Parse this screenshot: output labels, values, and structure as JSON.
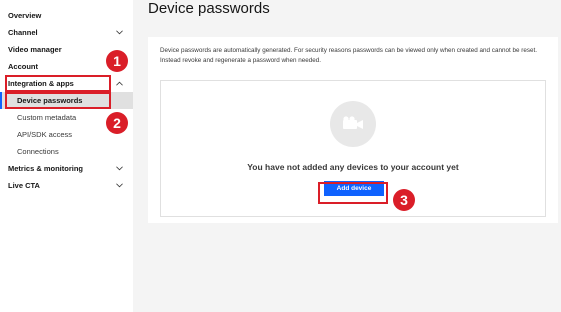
{
  "sidebar": {
    "items": [
      {
        "label": "Overview"
      },
      {
        "label": "Channel"
      },
      {
        "label": "Video manager"
      },
      {
        "label": "Account"
      },
      {
        "label": "Integration & apps"
      },
      {
        "label": "Metrics & monitoring"
      },
      {
        "label": "Live CTA"
      }
    ],
    "sub_items": [
      {
        "label": "Device passwords",
        "active": true
      },
      {
        "label": "Custom metadata"
      },
      {
        "label": "API/SDK access"
      },
      {
        "label": "Connections"
      }
    ]
  },
  "main": {
    "title": "Device passwords",
    "intro": "Device passwords are automatically generated. For security reasons passwords can be viewed only when created and cannot be reset. Instead revoke and regenerate a password when needed.",
    "empty_state": {
      "message": "You have not added any devices to your account yet",
      "icon": "video-camera-icon",
      "button_label": "Add device"
    }
  },
  "annotations": {
    "step1": "1",
    "step2": "2",
    "step3": "3",
    "highlight_color": "#da1e28"
  },
  "colors": {
    "accent": "#0f62fe",
    "active_nav_bg": "#e0e0e0",
    "page_bg": "#f4f4f4"
  }
}
